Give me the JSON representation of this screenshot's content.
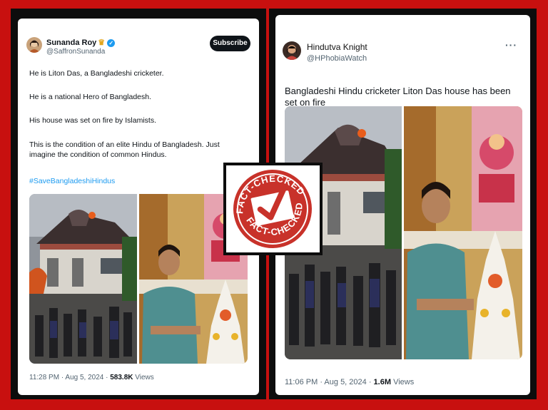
{
  "left_post": {
    "author_name": "Sunanda Roy",
    "handle": "@SaffronSunanda",
    "subscribe_label": "Subscribe",
    "paragraphs": [
      "He is Liton Das, a Bangladeshi cricketer.",
      "He is a national Hero of Bangladesh.",
      "His house was set on fire by Islamists.",
      "This is the condition of an elite Hindu of Bangladesh. Just imagine the condition of common Hindus."
    ],
    "hashtag": "#SaveBangladeshiHindus",
    "time": "11:28 PM · Aug 5, 2024 ·",
    "views_count": "583.8K",
    "views_label": "Views"
  },
  "right_post": {
    "author_name": "Hindutva Knight",
    "handle": "@HPhobiaWatch",
    "more_label": "···",
    "text": "Bangladeshi Hindu cricketer Liton Das house has been set on fire",
    "time": "11:06 PM · Aug 5, 2024 ·",
    "views_count": "1.6M",
    "views_label": "Views"
  },
  "stamp": {
    "top_text": "FACT-CHECKED",
    "bottom_text": "FACT-CHECKED",
    "color": "#c8322a"
  },
  "colors": {
    "background_red": "#c8100f",
    "frame_black": "#0d0d0d",
    "link_blue": "#1d9bf0"
  }
}
